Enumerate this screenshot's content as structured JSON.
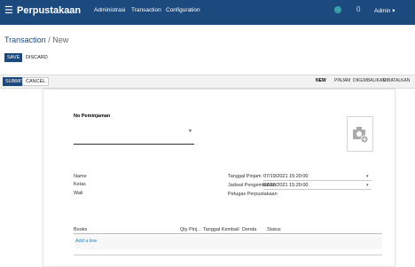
{
  "topbar": {
    "app_name": "Perpustakaan",
    "menus": [
      "Administrasi",
      "Transaction",
      "Configuration"
    ],
    "badge_count": "0",
    "user": "Admin ▾"
  },
  "breadcrumb": {
    "parent": "Transaction",
    "separator": " / ",
    "current": "New"
  },
  "actions": {
    "save": "SAVE",
    "discard": "DISCARD",
    "submit": "SUBMIT",
    "cancel": "CANCEL"
  },
  "stages": [
    "NEW",
    "PINJAM",
    "DIKEMBALIKAN",
    "DIBATALKAN"
  ],
  "active_stage": "NEW",
  "form": {
    "no_label": "No Peminjaman",
    "name_label": "Name",
    "kelas_label": "Kelas",
    "wali_label": "Wali",
    "tgl_pinjam_label": "Tanggal Pinjam",
    "tgl_pinjam_value": "07/19/2021 15:20:00",
    "jadwal_label": "Jadwal Pengembalian",
    "jadwal_value": "07/26/2021 15:20:00",
    "petugas_label": "Petugas Perpustakaan"
  },
  "lines_table": {
    "columns": [
      "Books",
      "Qty Pinj...",
      "Tanggal Kembali",
      "Denda",
      "Status"
    ],
    "add_line": "Add a line"
  },
  "colors": {
    "brand": "#1d4a7e",
    "link": "#1d84c6"
  }
}
